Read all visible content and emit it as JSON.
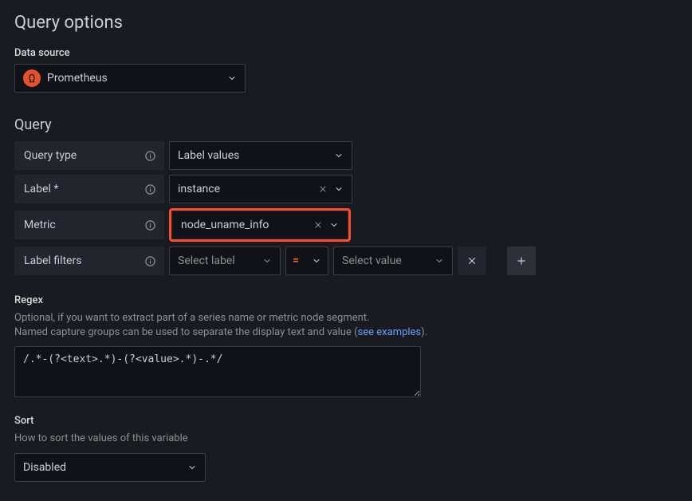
{
  "title": "Query options",
  "dataSource": {
    "label": "Data source",
    "value": "Prometheus"
  },
  "querySection": "Query",
  "queryType": {
    "label": "Query type",
    "value": "Label values"
  },
  "label": {
    "label": "Label *",
    "value": "instance"
  },
  "metric": {
    "label": "Metric",
    "value": "node_uname_info"
  },
  "labelFilters": {
    "label": "Label filters",
    "selectLabelPlaceholder": "Select label",
    "operator": "=",
    "selectValuePlaceholder": "Select value"
  },
  "regex": {
    "label": "Regex",
    "help1": "Optional, if you want to extract part of a series name or metric node segment.",
    "help2a": "Named capture groups can be used to separate the display text and value (",
    "helpLink": "see examples",
    "help2b": ").",
    "value": "/.*-(?<text>.*)-(?<value>.*)-.*/"
  },
  "sort": {
    "label": "Sort",
    "help": "How to sort the values of this variable",
    "value": "Disabled"
  }
}
